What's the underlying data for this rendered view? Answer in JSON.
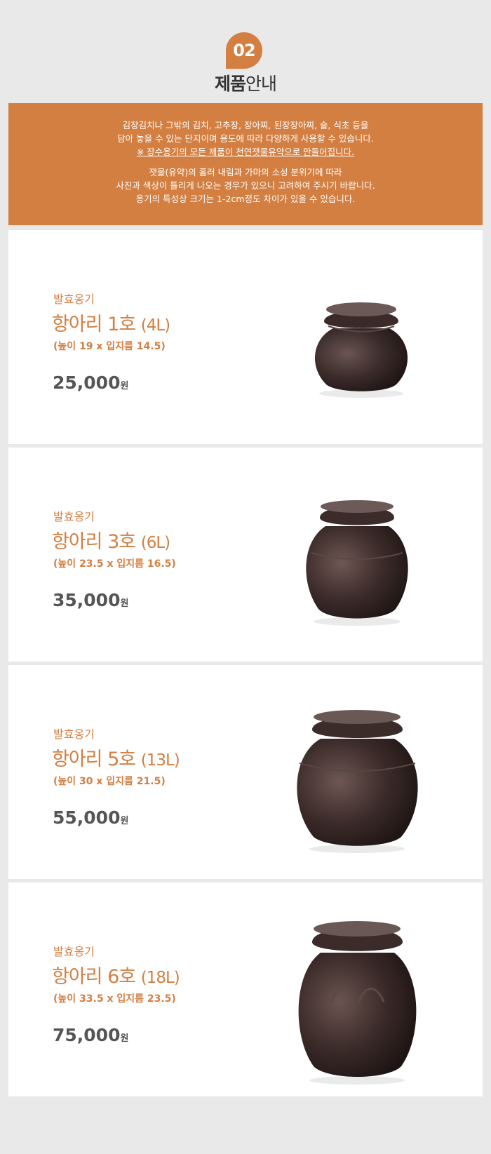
{
  "section": {
    "number": "02",
    "title_bold": "제품",
    "title_light": "안내"
  },
  "notice": {
    "line1": "김장김치나 그밖의 김치, 고추장, 장아찌, 된장장아찌, 술, 식초 등을",
    "line2": "담아 놓을 수 있는 단지이며 용도에 따라 다양하게 사용할 수 있습니다.",
    "line3": "※ 장수옹기의 모든 제품이 천연잿물유약으로 만들어집니다.",
    "line4": "잿물(유약)의 흘러 내림과 가마의 소성 분위기에 따라",
    "line5": "사진과 색상이 틀리게 나오는 경우가 있으니 고려하여 주시기 바랍니다.",
    "line6": "옹기의 특성상 크기는 1-2cm정도 차이가 있을 수 있습니다."
  },
  "products": [
    {
      "category": "발효옹기",
      "name": "항아리 1호",
      "volume": "(4L)",
      "size": "(높이 19 x 입지름 14.5)",
      "price": "25,000",
      "unit": "원"
    },
    {
      "category": "발효옹기",
      "name": "항아리 3호",
      "volume": "(6L)",
      "size": "(높이 23.5 x 입지름 16.5)",
      "price": "35,000",
      "unit": "원"
    },
    {
      "category": "발효옹기",
      "name": "항아리 5호",
      "volume": "(13L)",
      "size": "(높이 30 x 입지름 21.5)",
      "price": "55,000",
      "unit": "원"
    },
    {
      "category": "발효옹기",
      "name": "항아리 6호",
      "volume": "(18L)",
      "size": "(높이 33.5 x 입지름 23.5)",
      "price": "75,000",
      "unit": "원"
    }
  ],
  "colors": {
    "accent": "#d37f42",
    "background": "#e9e9e9",
    "jar": "#3a2a28"
  }
}
